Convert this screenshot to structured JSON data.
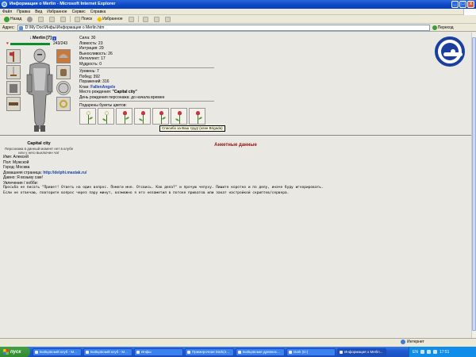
{
  "window": {
    "title": "Информация о Merlin - Microsoft Internet Explorer",
    "buttons": [
      "_",
      "□",
      "x"
    ]
  },
  "menu": [
    "Файл",
    "Правка",
    "Вид",
    "Избранное",
    "Сервис",
    "Справка"
  ],
  "toolbar": {
    "back": "Назад",
    "forward": "",
    "search": "Поиск",
    "favorites": "Избранное"
  },
  "address": {
    "label": "Адрес:",
    "value": "D:\\My Doc\\Инфы\\Информация о Merlin.htm",
    "go": "Переход"
  },
  "character": {
    "name": "Merlin",
    "level": "[7]",
    "hp_text": "243/243",
    "hp_fraction": 1.0,
    "city": "Capital city",
    "note": "Персонажа в данный момент нет в клубе или у него выключен чат"
  },
  "attributes": [
    "Сила: 30",
    "Ловкость: 23",
    "Интуиция: 29",
    "Выносливость: 26",
    "Интеллект: 17",
    "Мудрость: 0"
  ],
  "record": {
    "level": "Уровень: 7",
    "wins": "Побед: 392",
    "losses": "Поражений: 316",
    "clan_label": "Клан:",
    "clan": "FallenAngels",
    "birthplace_label": "Место рождения:",
    "birthplace": "\"Capital city\"",
    "birthday": "День рождения персонажа: до начала времен"
  },
  "flowers": {
    "label": "Подарены букеты цветов:",
    "tooltip": "Спасибо за Ваш труд! (клан Brigada)"
  },
  "profile": {
    "title": "Анкетные данные",
    "name": "Имя: Алексей",
    "gender": "Пол: Мужской",
    "city": "Город: Москва",
    "homepage_label": "Домашняя страница:",
    "homepage": "http://delphi.mastak.ru/",
    "age": "Давно: Я возьму сам!",
    "hobbies": "Увлечения / хобби:",
    "bio_1": "Просьба не писать \"Привет! Ответь на один вопрос. Помоги мне. Отсвись. Как дела?\" и прочую чепуху. Пишите коротко и по делу, иначе буду игнорировать.",
    "bio_2": "Если не отвечаю, повторите вопрос через пару минут, возможно я его незаметил в потоке приватов или закат настройкой скриптов/сервера."
  },
  "status": {
    "zone": "Интернет"
  },
  "taskbar": {
    "start": "пуск",
    "tasks": [
      "Бойцовский клуб - M...",
      "Бойцовский клуб - M...",
      "Инфы",
      "Примерочная Dark(2...",
      "Бойцовские древнос...",
      "Dark (D:)",
      "Информация о Merlin..."
    ],
    "lang": "EN",
    "clock": "17:51"
  },
  "colors": {
    "hp": "#0c8f2b",
    "section_title": "#8b1010",
    "link": "#1a44a8",
    "clan_logo": "#1a3f9c"
  }
}
